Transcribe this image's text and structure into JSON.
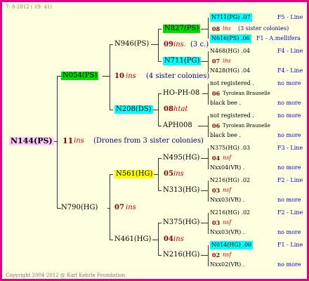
{
  "header": {
    "date": "7- 8-2012 ( 19: 41)"
  },
  "footer": {
    "copyright": "Copyright 2004-2012 @ Karl Kehrle Foundation."
  },
  "gen1": {
    "id": "N144(PS)"
  },
  "gen1_note": {
    "num": "11",
    "word": "ins",
    "desc": "(Drones from 3 sister colonies)"
  },
  "gen2": [
    {
      "id": "N054(PS)",
      "num": "10",
      "word": "ins",
      "desc": "(4 sister colonies)"
    },
    {
      "id": "N790(HG)",
      "num": "07",
      "word": "ins"
    }
  ],
  "gen3": [
    {
      "id": "N946(PS)",
      "num": "09",
      "word": "ins.",
      "desc": "(3 c.)"
    },
    {
      "id": "N208(DS)",
      "num": "08",
      "word": "htat"
    },
    {
      "id": "N561(HG)",
      "num": "05",
      "word": "ins"
    },
    {
      "id": "N461(HG)",
      "num": "04",
      "word": "ins"
    }
  ],
  "gen4": [
    {
      "id": "N827(PS)"
    },
    {
      "id": "N711(PG)"
    },
    {
      "id": "HO-PH-08"
    },
    {
      "id": "APH008"
    },
    {
      "id": "N495(HG)"
    },
    {
      "id": "N313(HG)"
    },
    {
      "id": "N375(HG)"
    },
    {
      "id": "N216(HG)"
    }
  ],
  "gen5": [
    {
      "top": "N711(PG) .07",
      "mid_num": "08",
      "mid_word": "ins",
      "mid_desc": "(3 sister colonies)",
      "bot": "N616(PS) .06",
      "top_line": "F5 - Line",
      "bot_line": "F1 - A.mellifera"
    },
    {
      "top": "N468(HG) .04",
      "mid_num": "07",
      "mid_word": "ins",
      "bot": "N428(HG) .04",
      "top_line": "F4 - Line",
      "bot_line": "F4 - Line"
    },
    {
      "top": "not registered .",
      "mid_num": "06",
      "mid_word": "Tyrolean Braunelle",
      "bot": "black bee .",
      "top_line": "no more",
      "bot_line": "no more"
    },
    {
      "top": "not registered .",
      "mid_num": "06",
      "mid_word": "Tyrolean Braunelle",
      "bot": "black bee .",
      "top_line": "no more",
      "bot_line": "no more"
    },
    {
      "top": "N375(HG) .03",
      "mid_num": "04",
      "mid_word": "nsf",
      "bot": "Nxx04(VR) .",
      "top_line": "F3 - Line",
      "bot_line": "no more"
    },
    {
      "top": "N216(HG) .02",
      "mid_num": "03",
      "mid_word": "nsf",
      "bot": "Nxx03(VR) .",
      "top_line": "F2 - Line",
      "bot_line": "no more"
    },
    {
      "top": "N216(HG) .02",
      "mid_num": "03",
      "mid_word": "nsf",
      "bot": "Nxx03(VR) .",
      "top_line": "F2 - Line",
      "bot_line": "no more"
    },
    {
      "top": "N014(HG) .00",
      "mid_num": "02",
      "mid_word": "nsf",
      "bot": "Nxx02(VR) .",
      "top_line": "F1 - Line",
      "bot_line": "no more"
    }
  ],
  "colors": {
    "frame": "#e0008a",
    "background": "#ffffe0",
    "cyan": "#00ffff",
    "green": "#00dd00",
    "yellow": "#ffff00",
    "pink": "#ffc8ff"
  }
}
